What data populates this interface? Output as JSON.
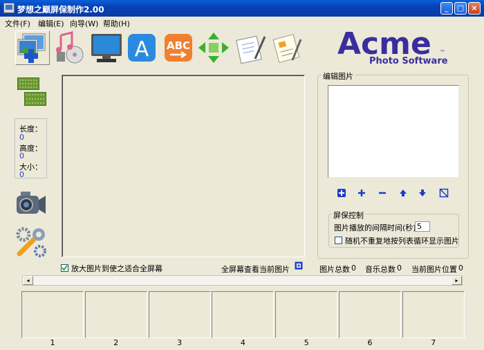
{
  "window": {
    "title": "梦想之巅屏保制作2.00",
    "minimize_glyph": "_",
    "maximize_glyph": "□",
    "close_glyph": "×"
  },
  "menu": [
    {
      "label": "文件(F)"
    },
    {
      "label": "编辑(E)"
    },
    {
      "label": "向导(W)"
    },
    {
      "label": "帮助(H)"
    }
  ],
  "toolbar": {
    "icons": [
      "images-add-icon",
      "music-icon",
      "monitor-icon",
      "text-a-icon",
      "abc-icon",
      "arrows-icon",
      "notepad-icon",
      "notes-icon"
    ]
  },
  "logo": {
    "line1": "Acme",
    "tm": "™",
    "line2": "Photo Software"
  },
  "info": {
    "length_label": "长度：",
    "length_value": "0",
    "height_label": "高度：",
    "height_value": "0",
    "size_label": "大小：",
    "size_value": "0"
  },
  "edit_panel": {
    "title": "编辑图片"
  },
  "screensaver": {
    "title": "屏保控制",
    "interval_label": "图片播放的间隔时间(秒)",
    "interval_value": "5",
    "random_label": "随机不重复地按列表循环显示图片",
    "random_checked": false
  },
  "options": {
    "fit_label": "放大图片到使之适合全屏幕",
    "fit_checked": true,
    "fullscreen_label": "全屏幕查看当前图片"
  },
  "stats": {
    "pic_total_label": "图片总数",
    "pic_total": "0",
    "music_total_label": "音乐总数",
    "music_total": "0",
    "current_pos_label": "当前图片位置",
    "current_pos": "0"
  },
  "scroll": {
    "left": "◂",
    "right": "▸"
  },
  "thumbnails": [
    "1",
    "2",
    "3",
    "4",
    "5",
    "6",
    "7"
  ],
  "colors": {
    "title_bar": "#0842b4",
    "accent_blue": "#1b3ec8",
    "face": "#ece9d8",
    "logo": "#3a2e9e"
  }
}
